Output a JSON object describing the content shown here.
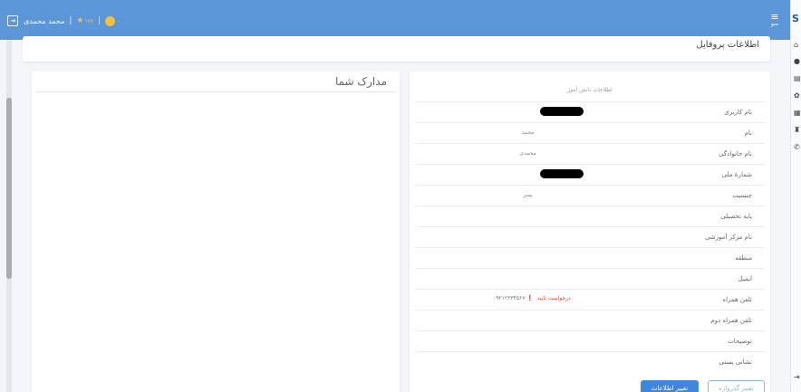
{
  "topbar": {
    "user_name": "محمد محمدی",
    "separator": "|",
    "star": "★",
    "score": "۱۷۷",
    "coin_value": "۰",
    "menu_label": "منو",
    "logout_glyph": "⇥"
  },
  "sidebar": {
    "logo_text": "S",
    "icons": [
      "home-icon",
      "user-icon",
      "calendar-icon",
      "settings-icon",
      "document-icon",
      "trophy-icon",
      "phone-icon",
      "logout-icon"
    ],
    "glyphs": [
      "⌂",
      "●",
      "▤",
      "✿",
      "▦",
      "♜",
      "✆",
      "⇥"
    ]
  },
  "page": {
    "title": "اطلاعات پروفایل",
    "documents_title": "مدارک شما",
    "info_caption": "اطلاعات دانش آموز"
  },
  "info_rows": [
    {
      "label": "نام کاربری",
      "value": ""
    },
    {
      "label": "نام",
      "value": "محمد"
    },
    {
      "label": "نام خانوادگی",
      "value": "محمدی"
    },
    {
      "label": "شمارهٔ ملی",
      "value": ""
    },
    {
      "label": "جنسیت",
      "value": "پسر"
    },
    {
      "label": "پایه تحصیلی",
      "value": ""
    },
    {
      "label": "نام مرکز آموزشی",
      "value": ""
    },
    {
      "label": "منطقه",
      "value": ""
    },
    {
      "label": "ایمیل",
      "value": ""
    },
    {
      "label": "تلفن همراه",
      "value": ""
    },
    {
      "label": "تلفن همراه دوم",
      "value": ""
    },
    {
      "label": "توضیحات",
      "value": ""
    },
    {
      "label": "نشانی پستی",
      "value": ""
    }
  ],
  "phone": {
    "number": "۰۹۲۱۲۳۳۴۵۶۷",
    "badge": "❗",
    "verify_link": "درخواست تایید"
  },
  "buttons": {
    "change_info": "تغییر اطلاعات",
    "change_password": "تغییر گذرواژه"
  },
  "colors": {
    "primary": "#5b96d8",
    "button_blue": "#3f87dc",
    "warning_red": "#e43c3c",
    "coin_yellow": "#f5c13a"
  }
}
